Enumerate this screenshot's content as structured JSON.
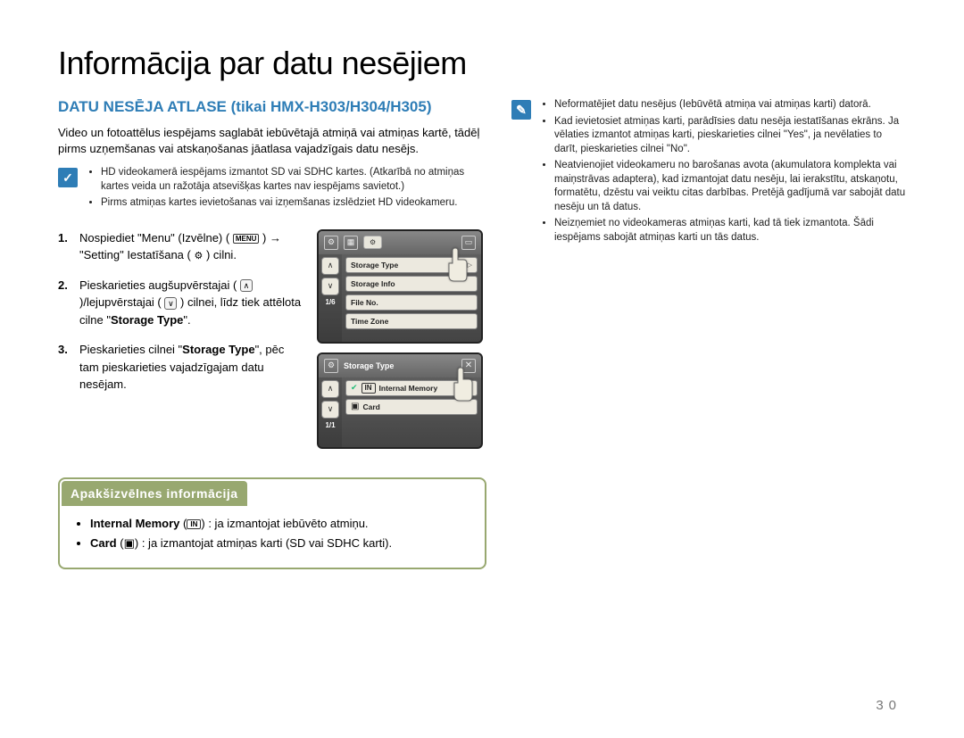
{
  "title": "Informācija par datu nesējiem",
  "section_heading": "DATU NESĒJA ATLASE (tikai HMX-H303/H304/H305)",
  "intro": "Video un fotoattēlus iespējams saglabāt iebūvētajā atmiņā vai atmiņas kartē, tādēļ pirms uzņemšanas vai atskaņošanas jāatlasa vajadzīgais datu nesējs.",
  "note_left": [
    "HD videokamerā iespējams izmantot SD vai SDHC kartes. (Atkarībā no atmiņas kartes veida un ražotāja atsevišķas kartes nav iespējams savietot.)",
    "Pirms atmiņas kartes ievietošanas vai izņemšanas izslēdziet HD videokameru."
  ],
  "steps": [
    {
      "num": "1.",
      "pre": "Nospiediet \"Menu\" (Izvēlne) (",
      "menu_tag": "MENU",
      "mid": ") → \"Setting\" Iestatīšana (",
      "gear": "⚙",
      "post": ") cilni."
    },
    {
      "num": "2.",
      "pre": "Pieskarieties augšupvērstajai (",
      "up": "∧",
      "mid": ")/lejupvērstajai (",
      "down": "∨",
      "post": ") cilnei, līdz tiek attēlota cilne \"",
      "bold": "Storage Type",
      "end": "\"."
    },
    {
      "num": "3.",
      "pre": "Pieskarieties cilnei \"",
      "bold": "Storage Type",
      "post": "\", pēc tam pieskarieties vajadzīgajam datu nesējam."
    }
  ],
  "screen1": {
    "page_indicator": "1/6",
    "rows": [
      {
        "label": "Storage Type",
        "right": ""
      },
      {
        "label": "Storage Info",
        "right": ""
      },
      {
        "label": "File No.",
        "right": ""
      },
      {
        "label": "Time Zone",
        "right": ""
      }
    ]
  },
  "screen2": {
    "title": "Storage Type",
    "page_indicator": "1/1",
    "rows": [
      {
        "label": "Internal Memory",
        "icon_text": "IN"
      },
      {
        "label": "Card",
        "icon": "▣"
      }
    ]
  },
  "info_panel": {
    "header": "Apakšizvēlnes informācija",
    "item1_label": "Internal Memory",
    "item1_icon": "IN",
    "item1_text": ": ja izmantojat iebūvēto atmiņu.",
    "item2_label": "Card",
    "item2_icon": "▣",
    "item2_text": ": ja izmantojat atmiņas karti (SD vai SDHC karti)."
  },
  "note_right": [
    "Neformatējiet datu nesējus (Iebūvētā atmiņa vai atmiņas karti) datorā.",
    "Kad ievietosiet atmiņas karti, parādīsies datu nesēja iestatīšanas ekrāns. Ja vēlaties izmantot atmiņas karti, pieskarieties cilnei \"Yes\", ja nevēlaties to darīt, pieskarieties cilnei \"No\".",
    "Neatvienojiet videokameru no barošanas avota (akumulatora komplekta vai maiņstrāvas adaptera), kad izmantojat datu nesēju, lai ierakstītu, atskaņotu, formatētu, dzēstu vai veiktu citas darbības. Pretējā gadījumā var sabojāt datu nesēju un tā datus.",
    "Neizņemiet no videokameras atmiņas karti, kad tā tiek izmantota. Šādi iespējams sabojāt atmiņas karti un tās datus."
  ],
  "page_number": "30"
}
